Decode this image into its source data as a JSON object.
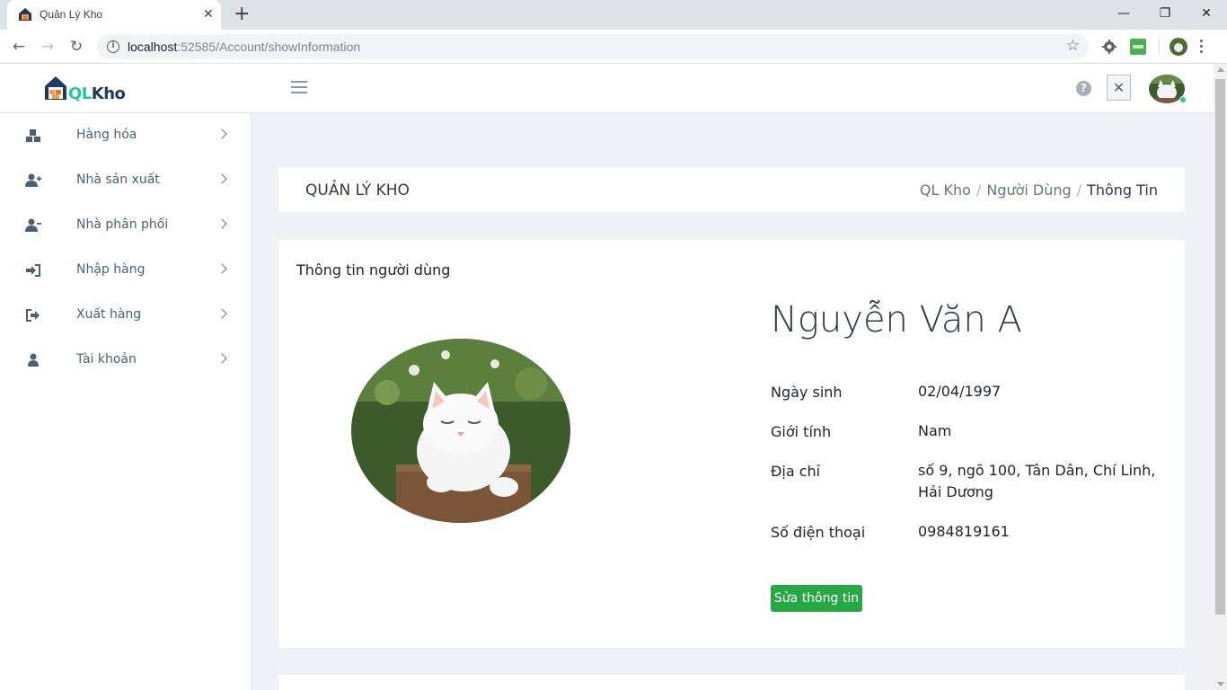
{
  "browser": {
    "tab_title": "Quản Lý Kho",
    "tab_close": "✕",
    "new_tab": "+",
    "url_host": "localhost",
    "url_rest": ":52585/Account/showInformation",
    "window_min": "—",
    "window_restore": "❐",
    "window_close": "✕",
    "back": "←",
    "forward": "→",
    "reload": "↻",
    "bookmark": "☆",
    "info_icon": "i"
  },
  "header": {
    "logo_ql": "QL",
    "logo_kho": "Kho",
    "help": "?",
    "close": "✕"
  },
  "sidebar": {
    "items": [
      {
        "label": "Hàng hóa",
        "icon": "boxes-icon"
      },
      {
        "label": "Nhà sản xuất",
        "icon": "user-plus-icon"
      },
      {
        "label": "Nhà phân phối",
        "icon": "user-minus-icon"
      },
      {
        "label": "Nhập hàng",
        "icon": "sign-in-icon"
      },
      {
        "label": "Xuất hàng",
        "icon": "sign-out-icon"
      },
      {
        "label": "Tài khoản",
        "icon": "user-icon"
      }
    ]
  },
  "page": {
    "title": "QUẢN LÝ KHO",
    "breadcrumb": [
      "QL Kho",
      "Người Dùng",
      "Thông Tin"
    ],
    "breadcrumb_sep": "/"
  },
  "profile": {
    "card_title": "Thông tin người dùng",
    "name": "Nguyễn Văn A",
    "fields": [
      {
        "label": "Ngày sinh",
        "value": "02/04/1997"
      },
      {
        "label": "Giới tính",
        "value": "Nam"
      },
      {
        "label": "Địa chỉ",
        "value": "số 9, ngõ 100, Tân Dân, Chí Linh, Hải Dương"
      },
      {
        "label": "Số điện thoại",
        "value": "0984819161"
      }
    ],
    "edit_button": "Sửa thông tin"
  },
  "colors": {
    "accent_green": "#28a745",
    "logo_teal": "#20c997",
    "online_dot": "#2ecc71"
  }
}
